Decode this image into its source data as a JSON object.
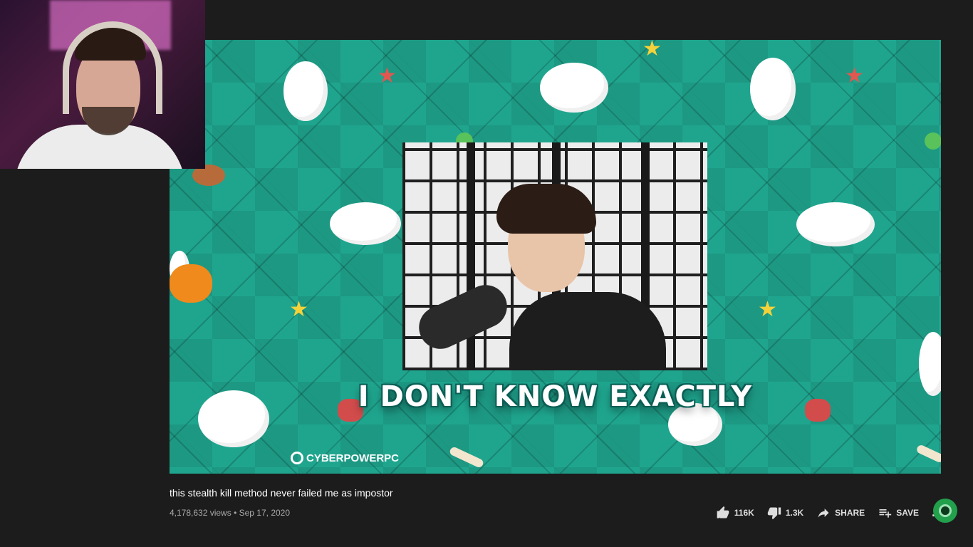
{
  "video": {
    "title": "this stealth kill method never failed me as impostor",
    "views": "4,178,632 views",
    "separator": "•",
    "date": "Sep 17, 2020",
    "caption": "I DON'T KNOW EXACTLY",
    "watermark": "CYBERPOWERPC"
  },
  "actions": {
    "like_count": "116K",
    "dislike_count": "1.3K",
    "share_label": "SHARE",
    "save_label": "SAVE",
    "more_label": "..."
  },
  "colors": {
    "background": "#1c1c1c",
    "player_teal": "#1fa58e",
    "text_secondary": "#aaaaaa"
  }
}
